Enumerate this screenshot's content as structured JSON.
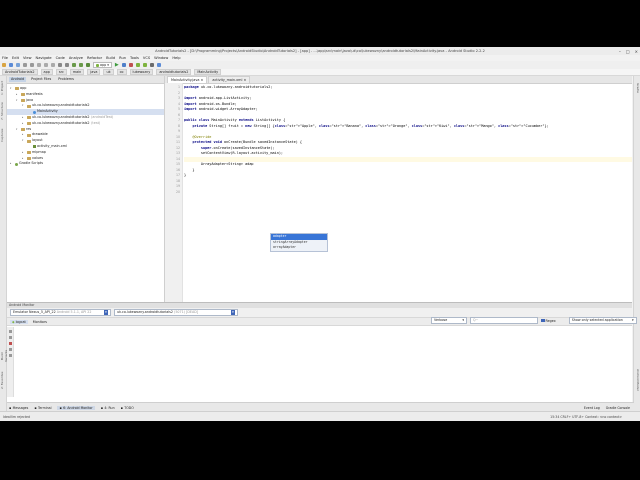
{
  "title": "AndroidTutorials2 - [D:\\Programming\\Projects\\AndroidStudio\\AndroidTutorials2] - [app] - ...\\app\\src\\main\\java\\uk\\co\\lukewozny\\androidtutorials2\\MainActivity.java - Android Studio 2.2.2",
  "menu": [
    "File",
    "Edit",
    "View",
    "Navigate",
    "Code",
    "Analyze",
    "Refactor",
    "Build",
    "Run",
    "Tools",
    "VCS",
    "Window",
    "Help"
  ],
  "toolbar": {
    "run_config": "app"
  },
  "breadcrumbs": [
    "AndroidTutorials2",
    "app",
    "src",
    "main",
    "java",
    "uk",
    "co",
    "lukewozny",
    "androidtutorials2",
    "MainActivity"
  ],
  "project_panel": {
    "tabs": [
      "Android",
      "Project Files",
      "Problems"
    ],
    "items": [
      {
        "label": "app",
        "indent": 0,
        "icon": "folder",
        "arrow": "▾"
      },
      {
        "label": "manifests",
        "indent": 1,
        "icon": "folder",
        "arrow": "▸"
      },
      {
        "label": "java",
        "indent": 1,
        "icon": "folder",
        "arrow": "▾"
      },
      {
        "label": "uk.co.lukewozny.androidtutorials2",
        "indent": 2,
        "icon": "folder",
        "arrow": "▾"
      },
      {
        "label": "MainActivity",
        "indent": 3,
        "icon": "class",
        "arrow": "",
        "selected": true
      },
      {
        "label": "uk.co.lukewozny.androidtutorials2",
        "suffix": "(androidTest)",
        "indent": 2,
        "icon": "folder",
        "arrow": "▸"
      },
      {
        "label": "uk.co.lukewozny.androidtutorials2",
        "suffix": "(test)",
        "indent": 2,
        "icon": "folder",
        "arrow": "▸"
      },
      {
        "label": "res",
        "indent": 1,
        "icon": "folder",
        "arrow": "▾"
      },
      {
        "label": "drawable",
        "indent": 2,
        "icon": "folder",
        "arrow": "▸"
      },
      {
        "label": "layout",
        "indent": 2,
        "icon": "folder",
        "arrow": "▾"
      },
      {
        "label": "activity_main.xml",
        "indent": 3,
        "icon": "xml",
        "arrow": ""
      },
      {
        "label": "mipmap",
        "indent": 2,
        "icon": "folder",
        "arrow": "▸"
      },
      {
        "label": "values",
        "indent": 2,
        "icon": "folder",
        "arrow": "▸"
      },
      {
        "label": "Gradle Scripts",
        "indent": 0,
        "icon": "gradle",
        "arrow": "▸"
      }
    ]
  },
  "editor": {
    "tabs": [
      "MainActivity.java",
      "activity_main.xml"
    ],
    "line_numbers": [
      "1",
      "2",
      "3",
      "4",
      "5",
      "6",
      "7",
      "8",
      "9",
      "10",
      "11",
      "12",
      "13",
      "14",
      "15",
      "16",
      "17",
      "18",
      "19",
      "20"
    ],
    "lines": [
      "package uk.co.lukewozny.androidtutorials2;",
      "",
      "import android.app.ListActivity;",
      "import android.os.Bundle;",
      "import android.widget.ArrayAdapter;",
      "",
      "public class MainActivity extends ListActivity {",
      "    private String[] fruit = new String[] {\"Apple\", \"Banana\", \"Orange\", \"Kiwi\", \"Mango\", \"Cucumber\"};",
      "",
      "    @Override",
      "    protected void onCreate(Bundle savedInstanceState) {",
      "        super.onCreate(savedInstanceState);",
      "        setContentView(R.layout.activity_main);",
      "",
      "        ArrayAdapter<String> adap",
      "    }",
      "}"
    ],
    "autocomplete": [
      "adapter",
      "stringArrayAdapter",
      "arrayAdapter"
    ]
  },
  "monitor": {
    "title": "Android Monitor",
    "device": "Emulator Nexus_5_API_22",
    "device_detail": "Android 5.1.1, API 22",
    "process": "uk.co.lukewozny.androidtutorials2",
    "process_detail": "(5071) [DEAD]",
    "tabs": [
      "logcat",
      "Monitors"
    ],
    "log_level": "Verbose",
    "search_placeholder": "Q~",
    "regex_label": "Regex",
    "filter": "Show only selected application"
  },
  "bottom_tabs": [
    "Messages",
    "Terminal",
    "6: Android Monitor",
    "4: Run",
    "TODO"
  ],
  "bottom_right": [
    "Event Log",
    "Gradle Console"
  ],
  "status": {
    "left": "IdeaVim rejected",
    "right": "15:34  CRLF÷  UTF-8÷  Context: <no context>"
  },
  "colors": {
    "keyword": "#000080",
    "string": "#008000",
    "annotation": "#808000",
    "selection": "#3875d7"
  }
}
